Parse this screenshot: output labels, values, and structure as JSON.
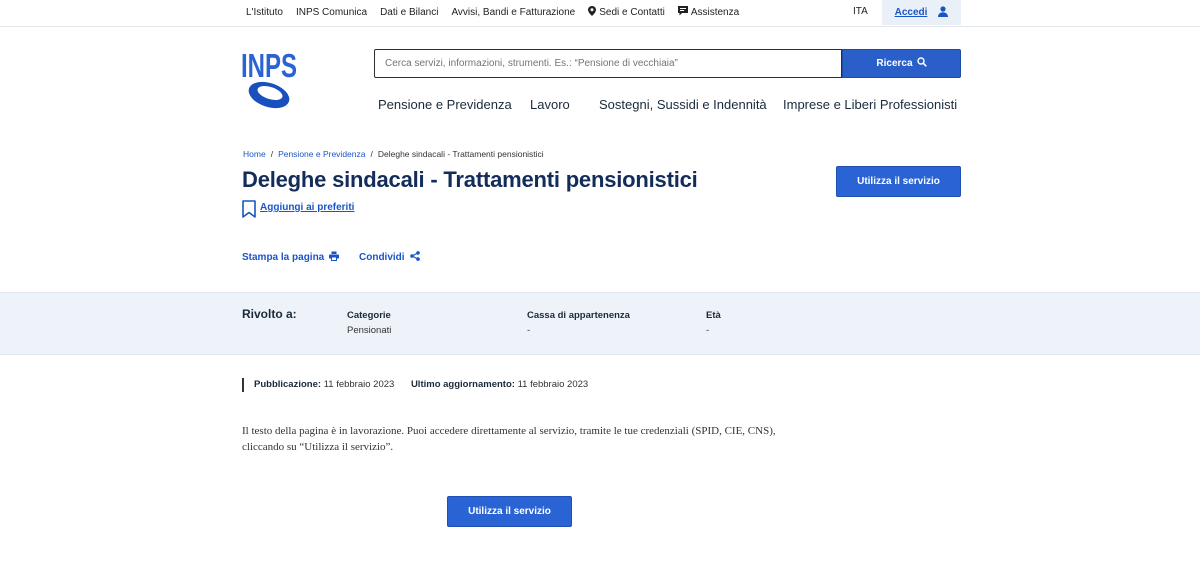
{
  "topbar": {
    "items": [
      {
        "label": "L'Istituto"
      },
      {
        "label": "INPS Comunica"
      },
      {
        "label": "Dati e Bilanci"
      },
      {
        "label": "Avvisi, Bandi e Fatturazione"
      },
      {
        "label": "Sedi e Contatti",
        "icon": "map-pin-icon"
      },
      {
        "label": "Assistenza",
        "icon": "chat-icon"
      }
    ],
    "language": "ITA",
    "login": {
      "label": "Accedi",
      "icon": "user-icon"
    }
  },
  "logo": {
    "text": "INPS"
  },
  "search": {
    "placeholder": "Cerca servizi, informazioni, strumenti. Es.: “Pensione di vecchiaia”",
    "button_label": "Ricerca",
    "button_icon": "search-icon"
  },
  "main_nav": {
    "items": [
      {
        "label": "Pensione e Previdenza"
      },
      {
        "label": "Lavoro"
      },
      {
        "label": "Sostegni, Sussidi e Indennità"
      },
      {
        "label": "Imprese e Liberi Professionisti"
      }
    ]
  },
  "breadcrumb": {
    "items": [
      {
        "label": "Home"
      },
      {
        "label": "Pensione e Previdenza"
      },
      {
        "label": "Deleghe sindacali - Trattamenti pensionistici"
      }
    ],
    "separator": "/"
  },
  "page": {
    "title": "Deleghe sindacali - Trattamenti pensionistici",
    "favorite_label": "Aggiungi ai preferiti",
    "cta_label": "Utilizza il servizio",
    "print_label": "Stampa la pagina",
    "share_label": "Condividi"
  },
  "audience": {
    "title": "Rivolto a:",
    "columns": [
      {
        "header": "Categorie",
        "value": "Pensionati"
      },
      {
        "header": "Cassa di appartenenza",
        "value": "-"
      },
      {
        "header": "Età",
        "value": "-"
      }
    ]
  },
  "meta": {
    "published_label": "Pubblicazione:",
    "published_value": "11 febbraio 2023",
    "updated_label": "Ultimo aggiornamento:",
    "updated_value": "11 febbraio 2023"
  },
  "content": {
    "body": "Il testo della pagina è in lavorazione. Puoi accedere direttamente al servizio, tramite le tue credenziali (SPID, CIE, CNS), cliccando su “Utilizza il servizio”.",
    "cta_label": "Utilizza il servizio"
  },
  "colors": {
    "primary": "#2a63d4",
    "title": "#132c5a",
    "link": "#1a55c8",
    "band": "#eef3f9"
  }
}
